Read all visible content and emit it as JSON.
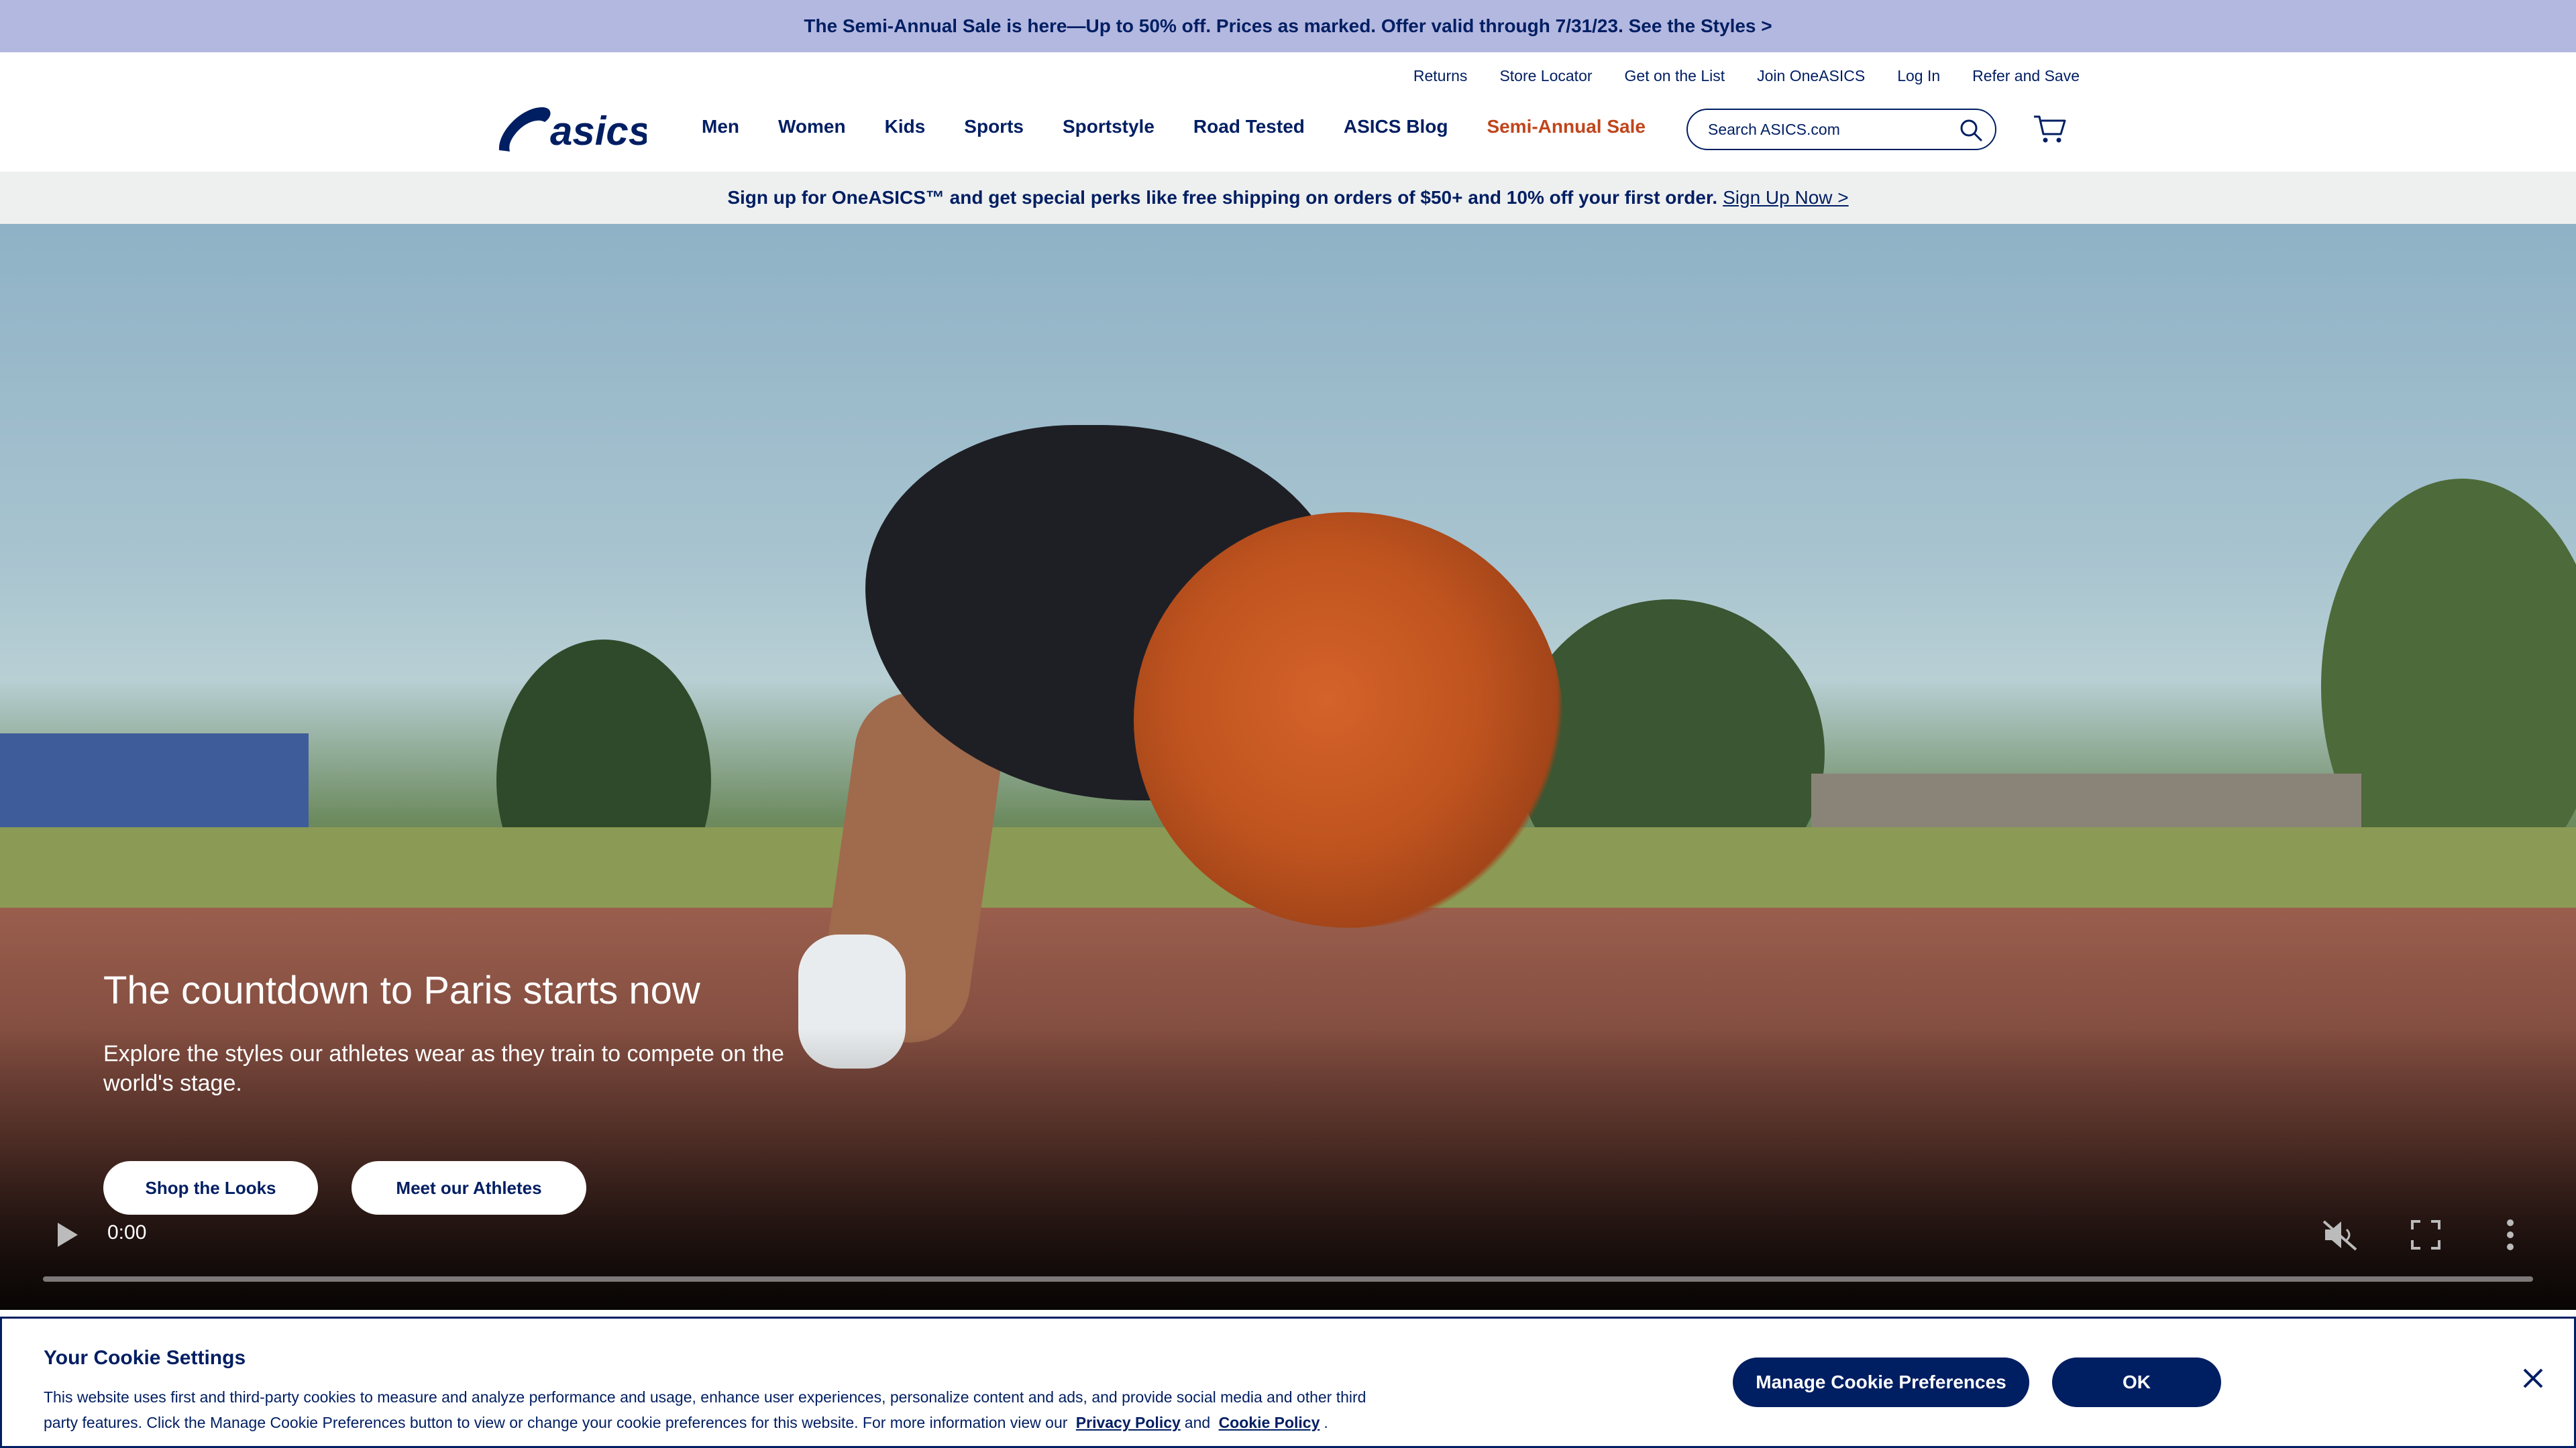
{
  "promo": {
    "text": "The Semi-Annual Sale is here—Up to 50% off. Prices as marked. Offer valid through 7/31/23. See the Styles >"
  },
  "utility_nav": [
    "Returns",
    "Store Locator",
    "Get on the List",
    "Join OneASICS",
    "Log In",
    "Refer and Save"
  ],
  "logo": {
    "text": "asics"
  },
  "main_nav": [
    {
      "label": "Men"
    },
    {
      "label": "Women"
    },
    {
      "label": "Kids"
    },
    {
      "label": "Sports"
    },
    {
      "label": "Sportstyle"
    },
    {
      "label": "Road Tested"
    },
    {
      "label": "ASICS Blog"
    },
    {
      "label": "Semi-Annual Sale",
      "highlight": "#c0451b"
    }
  ],
  "search": {
    "placeholder": "Search ASICS.com",
    "icon": "search-icon"
  },
  "cart": {
    "icon": "cart-icon"
  },
  "signup": {
    "text": "Sign up for OneASICS™ and get special perks like free shipping on orders of $50+ and 10% off your first order.",
    "link": "Sign Up Now >"
  },
  "hero": {
    "title": "The countdown to Paris starts now",
    "subtitle": "Explore the styles our athletes wear as they train to compete on the world's stage.",
    "buttons": {
      "shop": "Shop the Looks",
      "meet": "Meet our Athletes"
    }
  },
  "video_controls": {
    "time": "0:00",
    "icons": [
      "play-icon",
      "muted-icon",
      "fullscreen-icon",
      "more-options-icon"
    ]
  },
  "cookie": {
    "title": "Your Cookie Settings",
    "text_1": "This website uses first and third-party cookies to measure and analyze performance and usage, enhance user experiences, personalize content and ads, and provide social media and other third party features. Click the Manage Cookie Preferences button to view or change your cookie preferences for this website. For more information view our",
    "privacy_link": "Privacy Policy",
    "and": "and",
    "cookie_link": "Cookie Policy",
    "period": ".",
    "manage_button": "Manage Cookie Preferences",
    "ok_button": "OK"
  },
  "colors": {
    "brand_navy": "#001e62",
    "sale_red": "#c0451b",
    "promo_bg": "#b3b8e0",
    "signup_bg": "#eef0f0"
  }
}
